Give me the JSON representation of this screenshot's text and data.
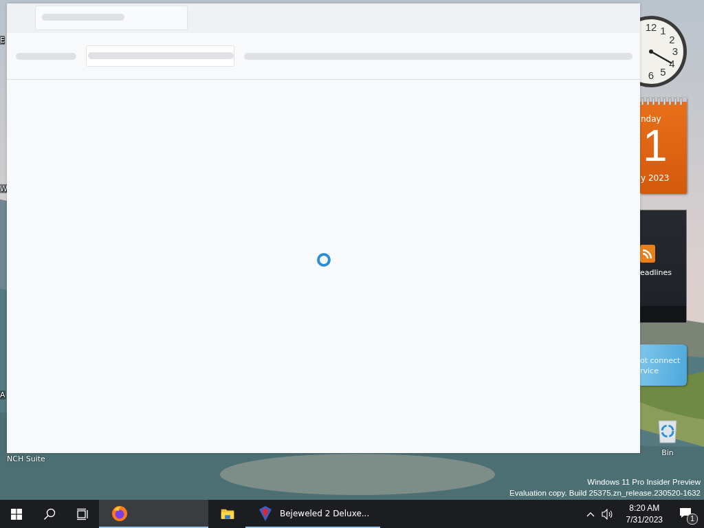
{
  "desktop": {
    "left_icon_labels": [
      "E",
      "W",
      "A"
    ],
    "bottom_icon_label": "NCH Suite",
    "recycle_bin": {
      "label": "Bin"
    }
  },
  "gadgets": {
    "clock": {
      "numerals": [
        "12",
        "1",
        "2",
        "3",
        "4",
        "6",
        "5"
      ]
    },
    "calendar": {
      "weekday": "nday",
      "day": "1",
      "month_year": "y 2023"
    },
    "headlines": {
      "title": "eadlines"
    },
    "message": {
      "lines": [
        "ot connect",
        "rvice"
      ]
    }
  },
  "window": {
    "loading": true
  },
  "watermark": [
    "Windows 11 Pro Insider Preview",
    "Evaluation copy. Build 25375.zn_release.230520-1632"
  ],
  "taskbar": {
    "apps": [
      {
        "kind": "firefox",
        "selected": true,
        "running": true
      },
      {
        "kind": "explorer",
        "selected": false,
        "running": false
      },
      {
        "kind": "bejeweled",
        "label": "Bejeweled 2 Deluxe...",
        "selected": false,
        "running": true
      }
    ],
    "time": "8:20 AM",
    "date": "7/31/2023",
    "notification_count": "1"
  }
}
